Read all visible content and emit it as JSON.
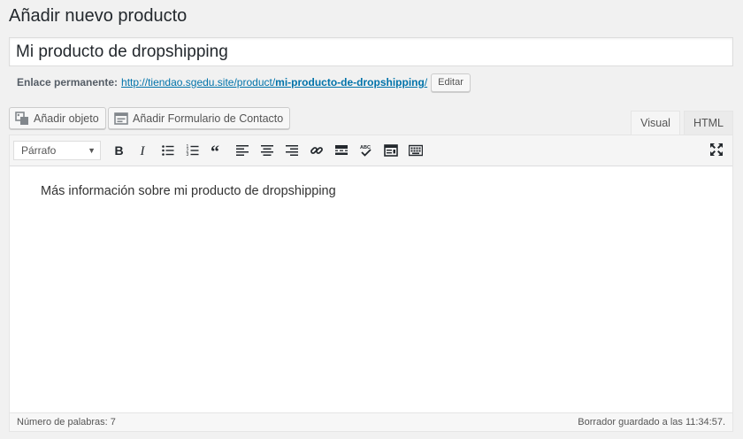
{
  "page": {
    "title": "Añadir nuevo producto"
  },
  "post_title": {
    "value": "Mi producto de dropshipping"
  },
  "permalink": {
    "label": "Enlace permanente:",
    "base": "http://tiendao.sgedu.site/product/",
    "slug": "mi-producto-de-dropshipping",
    "trail": "/",
    "edit_label": "Editar"
  },
  "media_buttons": [
    {
      "label": "Añadir objeto",
      "icon": "media-add-icon"
    },
    {
      "label": "Añadir Formulario de Contacto",
      "icon": "form-icon"
    }
  ],
  "editor_tabs": {
    "visual": "Visual",
    "html": "HTML"
  },
  "toolbar": {
    "format_selected": "Párrafo",
    "buttons": [
      "bold",
      "italic",
      "bullet-list",
      "numbered-list",
      "blockquote",
      "align-left",
      "align-center",
      "align-right",
      "link",
      "read-more",
      "spellcheck",
      "toolbar-toggle",
      "keyboard"
    ]
  },
  "content": {
    "text": "Más información sobre mi producto de dropshipping"
  },
  "status": {
    "word_count": "Número de palabras: 7",
    "draft_saved": "Borrador guardado a las 11:34:57."
  }
}
